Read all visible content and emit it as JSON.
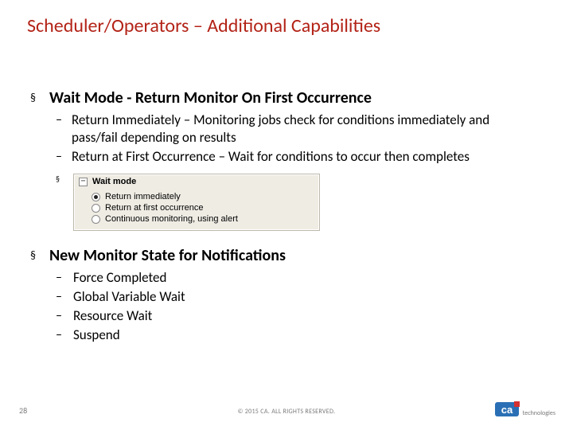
{
  "title": "Scheduler/Operators – Additional Capabilities",
  "section1": {
    "heading": "Wait Mode - Return Monitor On First Occurrence",
    "bullets": [
      "Return Immediately – Monitoring jobs check for conditions immediately and pass/fail depending on results",
      "Return at First Occurrence – Wait for  conditions to occur then completes"
    ]
  },
  "waitmode": {
    "toggle": "−",
    "title": "Wait mode",
    "options": [
      {
        "label": "Return immediately",
        "selected": true
      },
      {
        "label": "Return at first occurrence",
        "selected": false
      },
      {
        "label": "Continuous monitoring, using alert",
        "selected": false
      }
    ]
  },
  "section2": {
    "heading": "New Monitor State for Notifications",
    "items": [
      "Force Completed",
      "Global Variable Wait",
      "Resource Wait",
      "Suspend"
    ]
  },
  "footer": {
    "page": "28",
    "copyright": "© 2015 CA. ALL RIGHTS RESERVED.",
    "logo_tech": "technologies"
  }
}
